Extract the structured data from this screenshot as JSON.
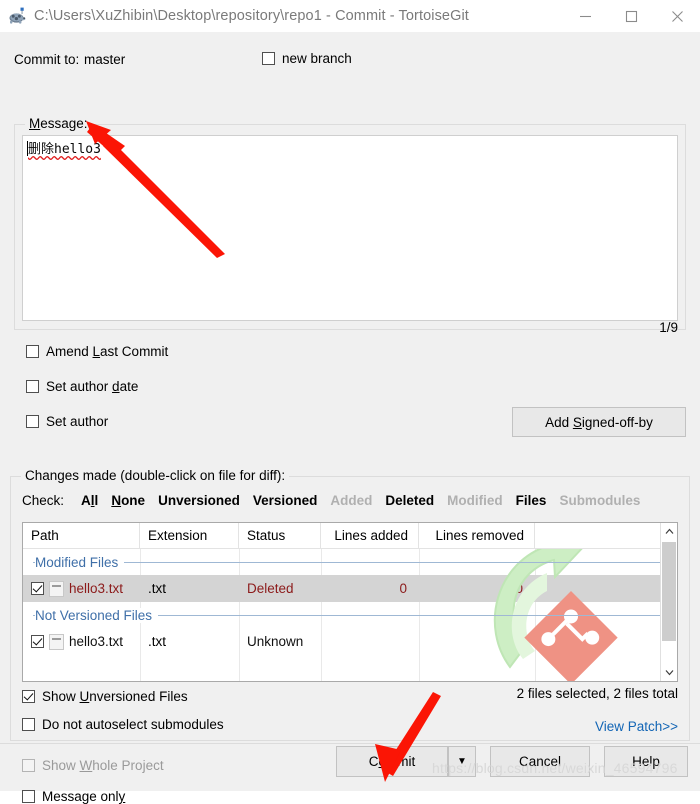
{
  "window": {
    "title": "C:\\Users\\XuZhibin\\Desktop\\repository\\repo1 - Commit - TortoiseGit",
    "icon": "tortoisegit-turtle-icon",
    "minimize": "—",
    "maximize": "□",
    "close": "✕"
  },
  "commit_to": {
    "label": "Commit to:",
    "branch": "master",
    "new_branch_label": "new branch",
    "new_branch_checked": false
  },
  "message": {
    "legend": "Message:",
    "text": "删除hello3",
    "counter": "1/9"
  },
  "options": {
    "amend": {
      "label_pre": "Amend ",
      "label_acc": "L",
      "label_post": "ast Commit",
      "checked": false
    },
    "set_author_date": {
      "label_pre": "Set author ",
      "label_acc": "d",
      "label_post": "ate",
      "checked": false
    },
    "set_author": {
      "label_pre": "Set author",
      "label_acc": "",
      "label_post": "",
      "checked": false
    },
    "add_signed_off_by": {
      "label_pre": "Add ",
      "label_acc": "S",
      "label_post": "igned-off-by"
    }
  },
  "changes": {
    "legend": "Changes made (double-click on file for diff):",
    "check_label": "Check:",
    "filters": [
      {
        "label_pre": "A",
        "label_acc": "l",
        "label_post": "l",
        "enabled": true
      },
      {
        "label_pre": "",
        "label_acc": "N",
        "label_post": "one",
        "enabled": true
      },
      {
        "label_pre": "Unversioned",
        "label_acc": "",
        "label_post": "",
        "enabled": true
      },
      {
        "label_pre": "Versioned",
        "label_acc": "",
        "label_post": "",
        "enabled": true
      },
      {
        "label_pre": "Added",
        "label_acc": "",
        "label_post": "",
        "enabled": false
      },
      {
        "label_pre": "Deleted",
        "label_acc": "",
        "label_post": "",
        "enabled": true
      },
      {
        "label_pre": "Modified",
        "label_acc": "",
        "label_post": "",
        "enabled": false
      },
      {
        "label_pre": "Files",
        "label_acc": "",
        "label_post": "",
        "enabled": true
      },
      {
        "label_pre": "Submodules",
        "label_acc": "",
        "label_post": "",
        "enabled": false
      }
    ],
    "columns": [
      "Path",
      "Extension",
      "Status",
      "Lines added",
      "Lines removed"
    ],
    "groups": [
      {
        "name": "Modified Files",
        "rows": [
          {
            "checked": true,
            "path": "hello3.txt",
            "extension": ".txt",
            "status": "Deleted",
            "lines_added": "0",
            "lines_removed": "0",
            "selected": true,
            "color": "red"
          }
        ]
      },
      {
        "name": "Not Versioned Files",
        "rows": [
          {
            "checked": true,
            "path": "hello3.txt",
            "extension": ".txt",
            "status": "Unknown",
            "lines_added": "",
            "lines_removed": "",
            "selected": false,
            "color": "black"
          }
        ]
      }
    ],
    "summary": "2 files selected, 2 files total",
    "view_patch": "View Patch>>",
    "show_unversioned": {
      "label_pre": "Show ",
      "label_acc": "U",
      "label_post": "nversioned Files",
      "checked": true
    },
    "no_autoselect_submodules": {
      "label_pre": "Do not autoselect submodules",
      "label_acc": "",
      "label_post": "",
      "checked": false
    }
  },
  "footer": {
    "show_whole_project": {
      "label_pre": "Show ",
      "label_acc": "W",
      "label_post": "hole Project",
      "checked": false,
      "disabled": true
    },
    "message_only": {
      "label_pre": "Message onl",
      "label_acc": "y",
      "label_post": "",
      "checked": false
    },
    "commit": {
      "label_pre": "C",
      "label_acc": "o",
      "label_post": "mmit"
    },
    "commit_dropdown": "▼",
    "cancel": "Cancel",
    "help": "Help"
  },
  "watermark": {
    "url": "https://blog.csdn.net/weixin_46594796",
    "logo": "tortoisegit-green-arrow-git-logo"
  },
  "colors": {
    "accent_link": "#1265b5",
    "group_header": "#3f6fa8",
    "file_red": "#8c1a1a",
    "annotation_red": "#fb1505",
    "watermark_green": "#c9ecc0",
    "watermark_pink": "#ef9284"
  }
}
